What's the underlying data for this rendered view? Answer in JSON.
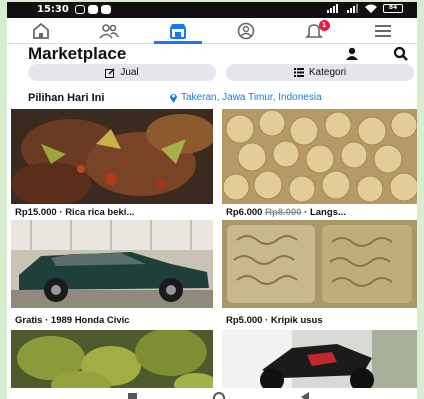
{
  "status_bar": {
    "time": "15:30",
    "battery": "84"
  },
  "nav": {
    "tabs": [
      {
        "name": "home"
      },
      {
        "name": "friends"
      },
      {
        "name": "marketplace",
        "active": true
      },
      {
        "name": "profile"
      },
      {
        "name": "notifications",
        "badge": "1"
      },
      {
        "name": "menu"
      }
    ]
  },
  "header": {
    "title": "Marketplace"
  },
  "actions": {
    "sell_label": "Jual",
    "categories_label": "Kategori"
  },
  "section": {
    "title": "Pilihan Hari Ini",
    "location": "Takeran, Jawa Timur, Indonesia"
  },
  "listings": [
    {
      "price": "Rp15.000",
      "title": "Rica rica beki...",
      "old_price": ""
    },
    {
      "price": "Rp6.000",
      "old_price": "Rp8.000",
      "title": "Langs..."
    },
    {
      "price": "Gratis",
      "title": "1989 Honda Civic",
      "old_price": ""
    },
    {
      "price": "Rp5.000",
      "title": "Kripik usus",
      "old_price": ""
    },
    {
      "price": "",
      "title": "",
      "old_price": ""
    },
    {
      "price": "",
      "title": "",
      "old_price": ""
    }
  ],
  "colors": {
    "accent": "#1877f2",
    "badge": "#e41e3f",
    "pill_bg": "#e4e6eb"
  }
}
